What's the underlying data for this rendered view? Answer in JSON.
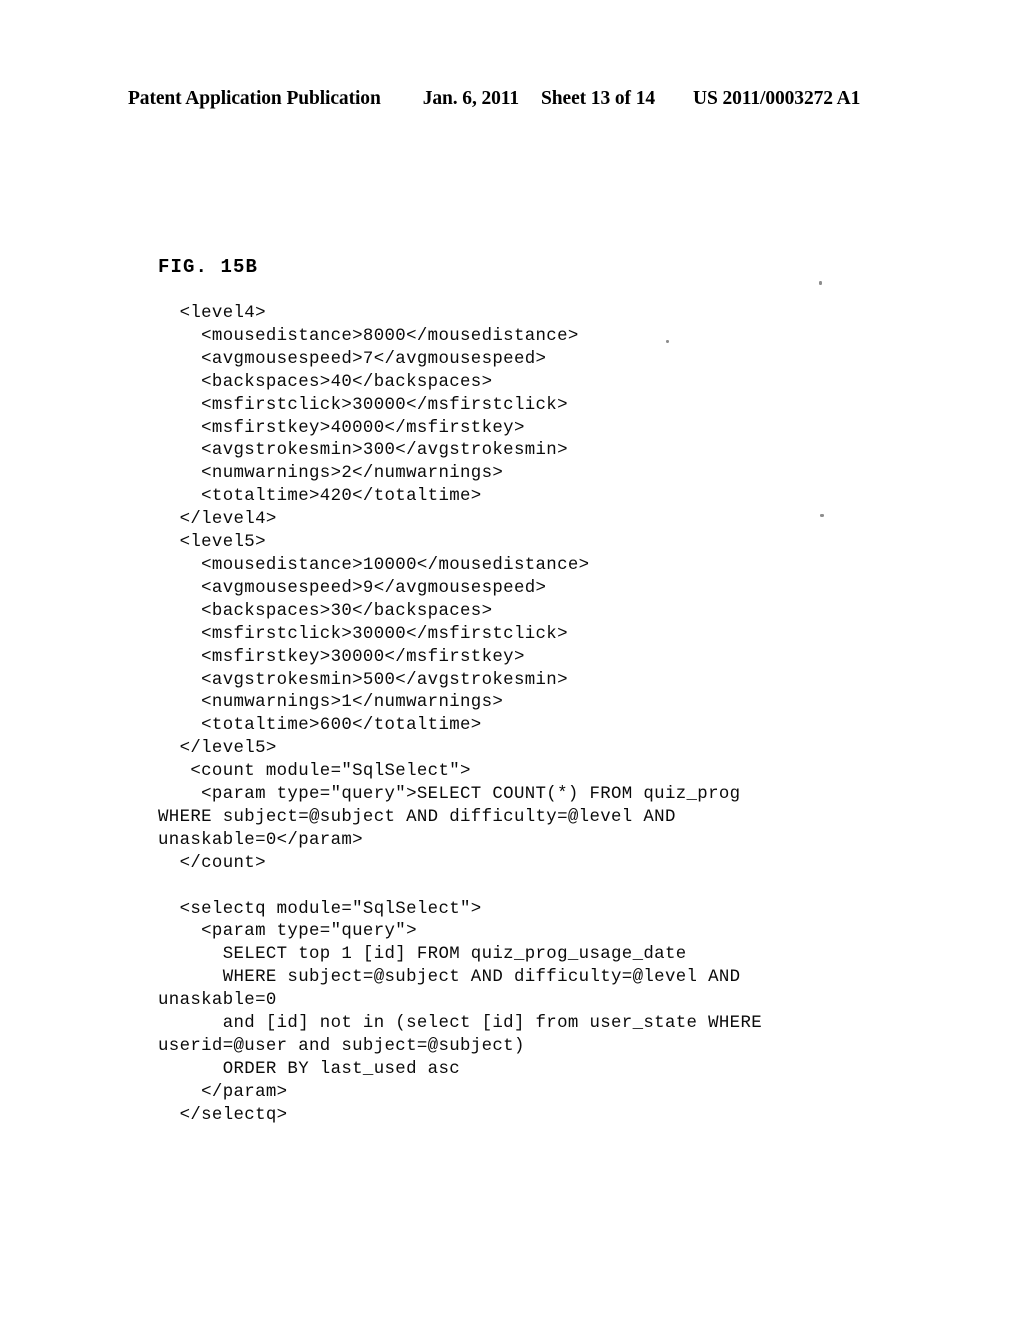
{
  "header": {
    "publication": "Patent Application Publication",
    "date": "Jan. 6, 2011",
    "sheet": "Sheet 13 of 14",
    "patent_number": "US 2011/0003272 A1"
  },
  "figure": {
    "label": "FIG. 15B"
  },
  "code": {
    "language": "xml",
    "lines": [
      "  <level4>",
      "    <mousedistance>8000</mousedistance>",
      "    <avgmousespeed>7</avgmousespeed>",
      "    <backspaces>40</backspaces>",
      "    <msfirstclick>30000</msfirstclick>",
      "    <msfirstkey>40000</msfirstkey>",
      "    <avgstrokesmin>300</avgstrokesmin>",
      "    <numwarnings>2</numwarnings>",
      "    <totaltime>420</totaltime>",
      "  </level4>",
      "  <level5>",
      "    <mousedistance>10000</mousedistance>",
      "    <avgmousespeed>9</avgmousespeed>",
      "    <backspaces>30</backspaces>",
      "    <msfirstclick>30000</msfirstclick>",
      "    <msfirstkey>30000</msfirstkey>",
      "    <avgstrokesmin>500</avgstrokesmin>",
      "    <numwarnings>1</numwarnings>",
      "    <totaltime>600</totaltime>",
      "  </level5>",
      "   <count module=\"SqlSelect\">",
      "    <param type=\"query\">SELECT COUNT(*) FROM quiz_prog",
      "WHERE subject=@subject AND difficulty=@level AND",
      "unaskable=0</param>",
      "  </count>",
      "",
      "  <selectq module=\"SqlSelect\">",
      "    <param type=\"query\">",
      "      SELECT top 1 [id] FROM quiz_prog_usage_date",
      "      WHERE subject=@subject AND difficulty=@level AND",
      "unaskable=0",
      "      and [id] not in (select [id] from user_state WHERE",
      "userid=@user and subject=@subject)",
      "      ORDER BY last_used asc",
      "    </param>",
      "  </selectq>"
    ]
  }
}
